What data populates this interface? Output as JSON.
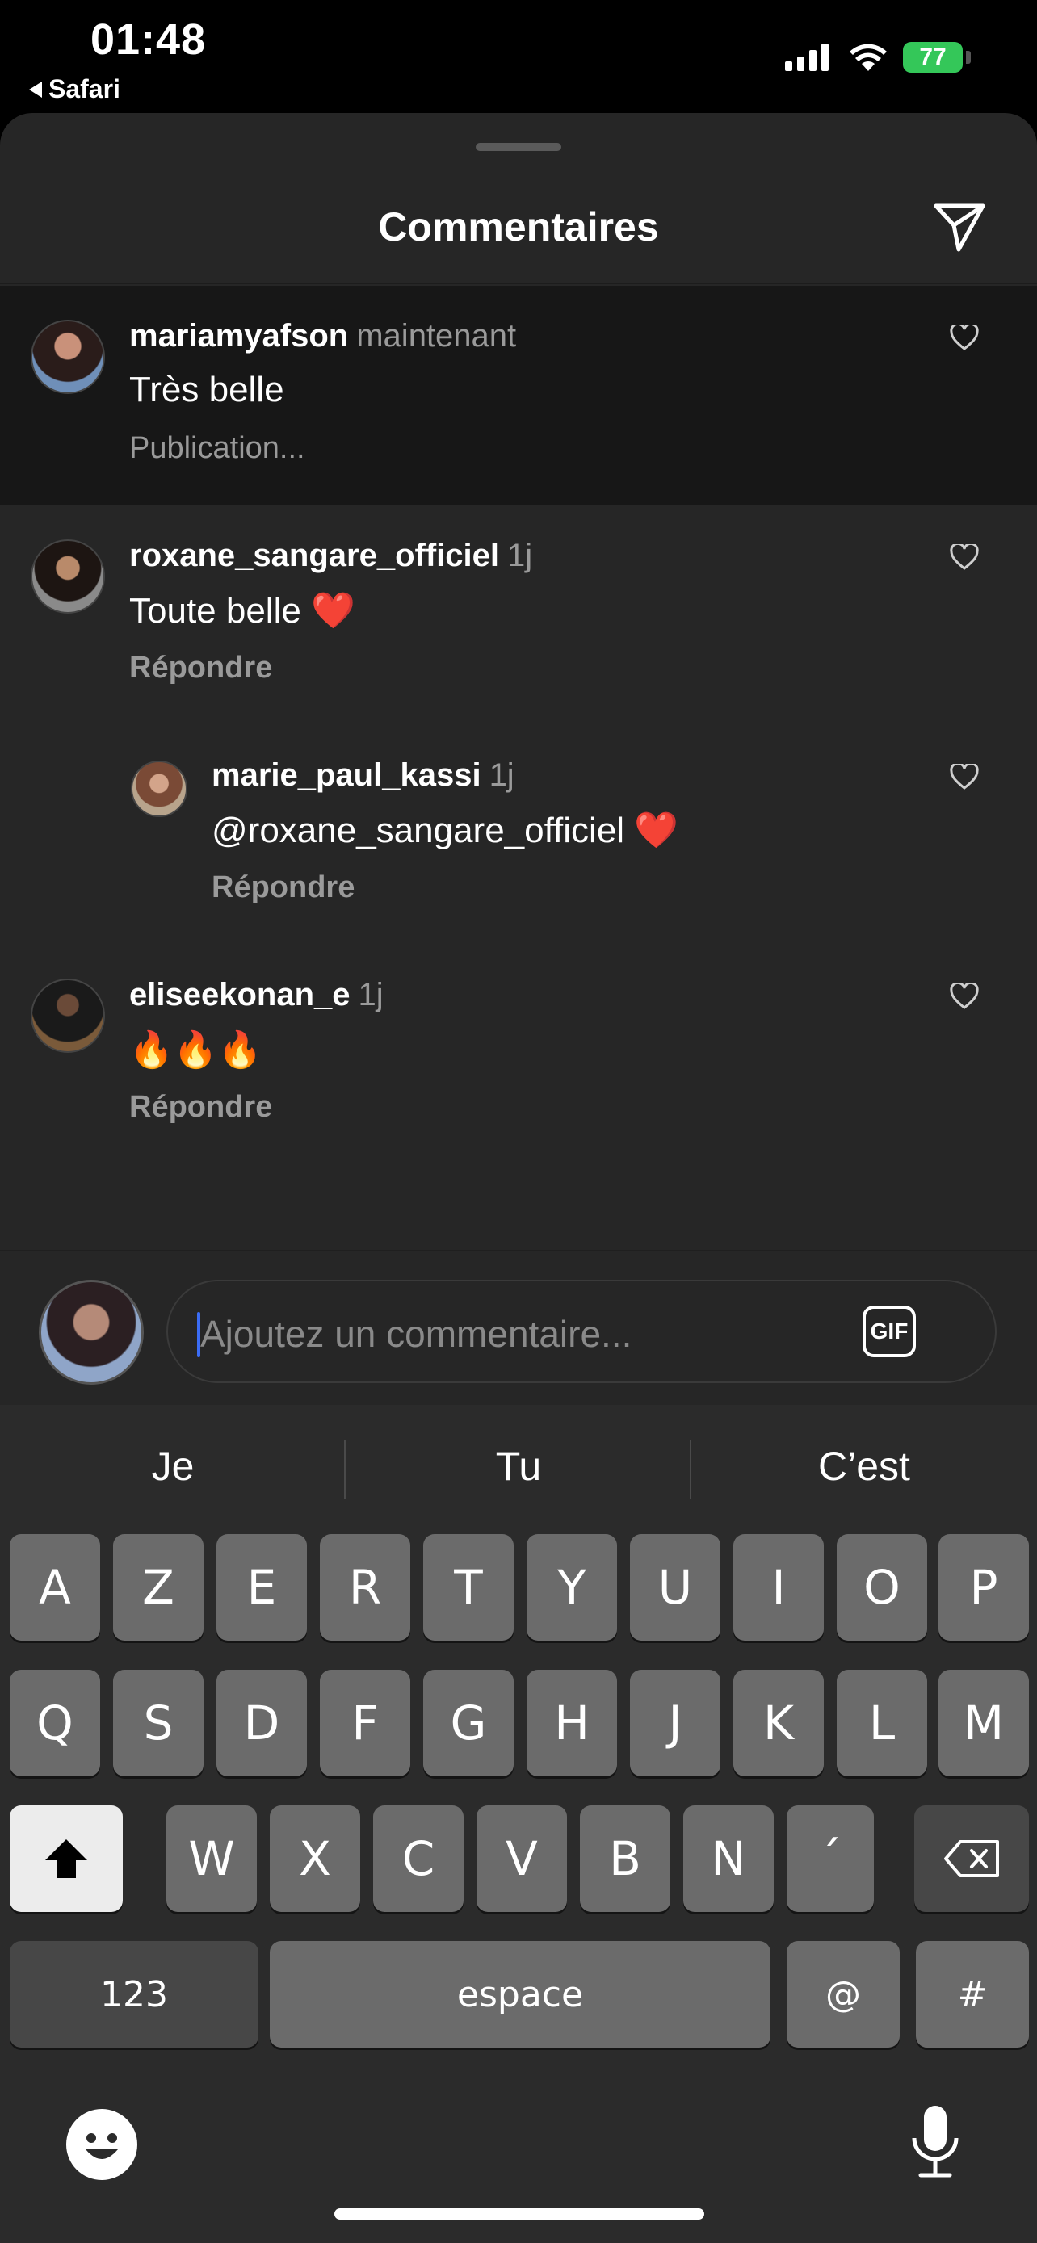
{
  "status": {
    "time": "01:48",
    "back_app": "Safari",
    "battery": "77"
  },
  "sheet": {
    "title": "Commentaires"
  },
  "comments": [
    {
      "user": "mariamyafson",
      "time": "maintenant",
      "text": "Très belle",
      "status": "Publication..."
    },
    {
      "user": "roxane_sangare_officiel",
      "time": "1j",
      "text": "Toute belle ❤️",
      "action": "Répondre"
    },
    {
      "user": "marie_paul_kassi",
      "time": "1j",
      "text": "@roxane_sangare_officiel ❤️",
      "action": "Répondre"
    },
    {
      "user": "eliseekonan_e",
      "time": "1j",
      "text": "🔥🔥🔥",
      "action": "Répondre"
    }
  ],
  "emoji_bar": [
    "❤️",
    "🙌",
    "🔥",
    "👏",
    "😢",
    "😍",
    "😮",
    "😂"
  ],
  "composer": {
    "placeholder": "Ajoutez un commentaire...",
    "gif_label": "GIF"
  },
  "keyboard": {
    "suggestions": [
      "Je",
      "Tu",
      "C’est"
    ],
    "row1": [
      "A",
      "Z",
      "E",
      "R",
      "T",
      "Y",
      "U",
      "I",
      "O",
      "P"
    ],
    "row2": [
      "Q",
      "S",
      "D",
      "F",
      "G",
      "H",
      "J",
      "K",
      "L",
      "M"
    ],
    "row3": [
      "W",
      "X",
      "C",
      "V",
      "B",
      "N",
      "´"
    ],
    "numbers_label": "123",
    "space_label": "espace",
    "at_label": "@",
    "hash_label": "#"
  },
  "colors": {
    "sheet_bg": "#262626",
    "pending_bg": "#171717",
    "muted_text": "#9a9a9a",
    "battery": "#34c759",
    "caret": "#3b6cf4"
  },
  "icons": [
    "signal-icon",
    "wifi-icon",
    "share-icon",
    "heart-outline-icon",
    "gif-icon",
    "shift-icon",
    "backspace-icon",
    "emoji-icon",
    "mic-icon"
  ]
}
